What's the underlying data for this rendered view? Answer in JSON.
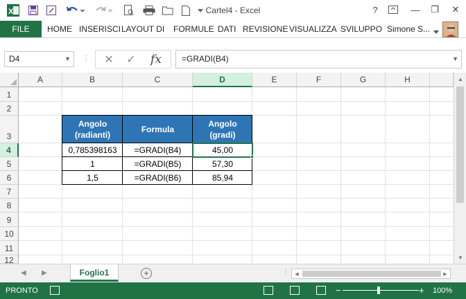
{
  "title": "Cartel4 - Excel",
  "window_buttons": {
    "help": "?",
    "minimize": "—",
    "restore": "❐",
    "close": "✕"
  },
  "quick_access": {
    "save_icon": "save-icon",
    "undo_icon": "undo-icon",
    "redo_icon": "redo-icon"
  },
  "ribbon": {
    "tabs": [
      "FILE",
      "HOME",
      "INSERISCI",
      "LAYOUT DI",
      "FORMULE",
      "DATI",
      "REVISIONE",
      "VISUALIZZA",
      "SVILUPPO"
    ],
    "user": "Simone S..."
  },
  "namebox": {
    "value": "D4"
  },
  "formula": {
    "value": "=GRADI(B4)",
    "fx_label": "fx"
  },
  "columns": [
    "A",
    "B",
    "C",
    "D",
    "E",
    "F",
    "G",
    "H"
  ],
  "selected_column": "D",
  "rows": [
    "1",
    "2",
    "3",
    "4",
    "5",
    "6",
    "7",
    "8",
    "9",
    "10",
    "11",
    "12"
  ],
  "selected_row": "4",
  "table": {
    "headers": [
      "Angolo\n(radianti)",
      "Formula",
      "Angolo\n(gradi)"
    ],
    "rows": [
      [
        "0,785398163",
        "=GRADI(B4)",
        "45,00"
      ],
      [
        "1",
        "=GRADI(B5)",
        "57,30"
      ],
      [
        "1,5",
        "=GRADI(B6)",
        "85,94"
      ]
    ],
    "header_color": "#2E75B6"
  },
  "sheet_tabs": [
    "Foglio1"
  ],
  "status": {
    "text": "PRONTO",
    "zoom": "100%",
    "minus": "−",
    "plus": "+"
  },
  "accent_color": "#217346"
}
